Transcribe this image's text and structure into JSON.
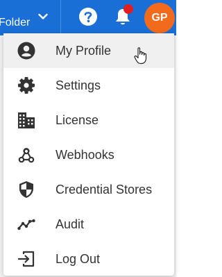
{
  "colors": {
    "topbar": "#1a6fd6",
    "avatar": "#f26a1b",
    "notification_dot": "#e02020",
    "menu_text": "#333333",
    "hover_row": "#f0f0f0"
  },
  "topbar": {
    "folder_label": "Folder",
    "help_icon": "question-circle-icon",
    "notifications_icon": "bell-icon",
    "avatar_initials": "GP"
  },
  "menu": {
    "items": [
      {
        "label": "My Profile",
        "icon": "account-circle-icon",
        "hovered": true
      },
      {
        "label": "Settings",
        "icon": "gear-icon"
      },
      {
        "label": "License",
        "icon": "building-icon"
      },
      {
        "label": "Webhooks",
        "icon": "webhook-icon"
      },
      {
        "label": "Credential Stores",
        "icon": "shield-icon"
      },
      {
        "label": "Audit",
        "icon": "line-chart-icon"
      },
      {
        "label": "Log Out",
        "icon": "logout-icon"
      }
    ]
  }
}
